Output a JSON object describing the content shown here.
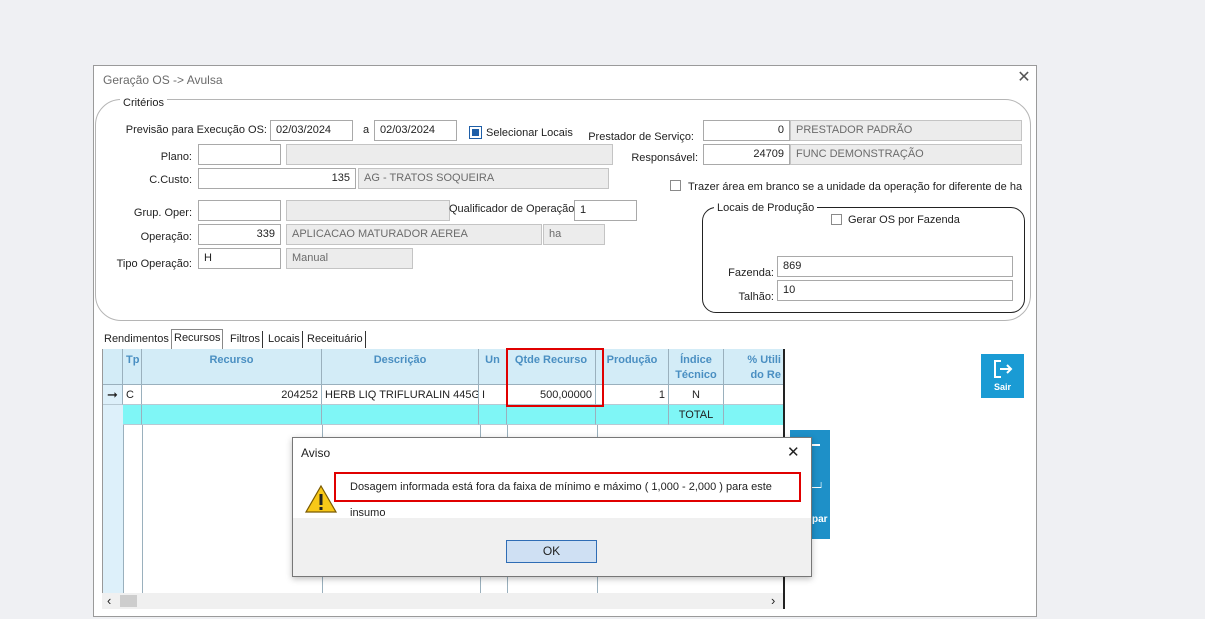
{
  "window": {
    "title": "Geração OS -> Avulsa",
    "close_glyph": "✕"
  },
  "criteria": {
    "legend": "Critérios",
    "previsao_label": "Previsão para Execução OS:",
    "date_from": "02/03/2024",
    "date_sep": "a",
    "date_to": "02/03/2024",
    "selecionar_locais_label": "Selecionar Locais",
    "selecionar_locais_checked": true,
    "prestador_label": "Prestador de Serviço:",
    "prestador_code": "0",
    "prestador_name": "PRESTADOR PADRÃO",
    "responsavel_label": "Responsável:",
    "responsavel_code": "24709",
    "responsavel_name": "FUNC DEMONSTRAÇÃO",
    "plano_label": "Plano:",
    "plano_code": "",
    "plano_name": "",
    "ccusto_label": "C.Custo:",
    "ccusto_code": "135",
    "ccusto_name": "AG - TRATOS SOQUEIRA",
    "trazer_area_label": "Trazer área em branco se a unidade da operação for diferente de ha",
    "grup_oper_label": "Grup. Oper:",
    "grup_oper_code": "",
    "grup_oper_name": "",
    "qualificador_label": "Qualificador de Operação",
    "qualificador_value": "1",
    "operacao_label": "Operação:",
    "operacao_code": "339",
    "operacao_name": "APLICACAO MATURADOR AEREA",
    "operacao_unit": "ha",
    "tipo_operacao_label": "Tipo Operação:",
    "tipo_operacao_code": "H",
    "tipo_operacao_name": "Manual"
  },
  "locais": {
    "legend": "Locais de Produção",
    "gerar_os_label": "Gerar OS por Fazenda",
    "fazenda_label": "Fazenda:",
    "fazenda_value": "869",
    "talhao_label": "Talhão:",
    "talhao_value": "10"
  },
  "tabs": [
    "Rendimentos",
    "Recursos",
    "Filtros",
    "Locais",
    "Receituário"
  ],
  "grid": {
    "headers": {
      "tp": "Tp",
      "recurso": "Recurso",
      "descricao": "Descrição",
      "un": "Un",
      "qtde": "Qtde Recurso",
      "producao": "Produção",
      "indice1": "Índice",
      "indice2": "Técnico",
      "util1": "% Utili",
      "util2": "do Re"
    },
    "row": {
      "pointer": "➞",
      "tp": "C",
      "recurso": "204252",
      "descricao": "HERB LIQ TRIFLURALIN 445G",
      "un": "I",
      "qtde": "500,00000",
      "producao": "1",
      "indice": "N"
    },
    "total_label": "TOTAL"
  },
  "sair_label": "Sair",
  "behind_label": "par",
  "dialog": {
    "title": "Aviso",
    "close_glyph": "✕",
    "message": "Dosagem informada está fora da faixa de mínimo e máximo ( 1,000 - 2,000 ) para este insumo",
    "ok_label": "OK"
  },
  "icons": [
    "close-icon",
    "warning-icon",
    "exit-icon",
    "row-pointer-icon",
    "scroll-left-icon",
    "scroll-right-icon"
  ]
}
